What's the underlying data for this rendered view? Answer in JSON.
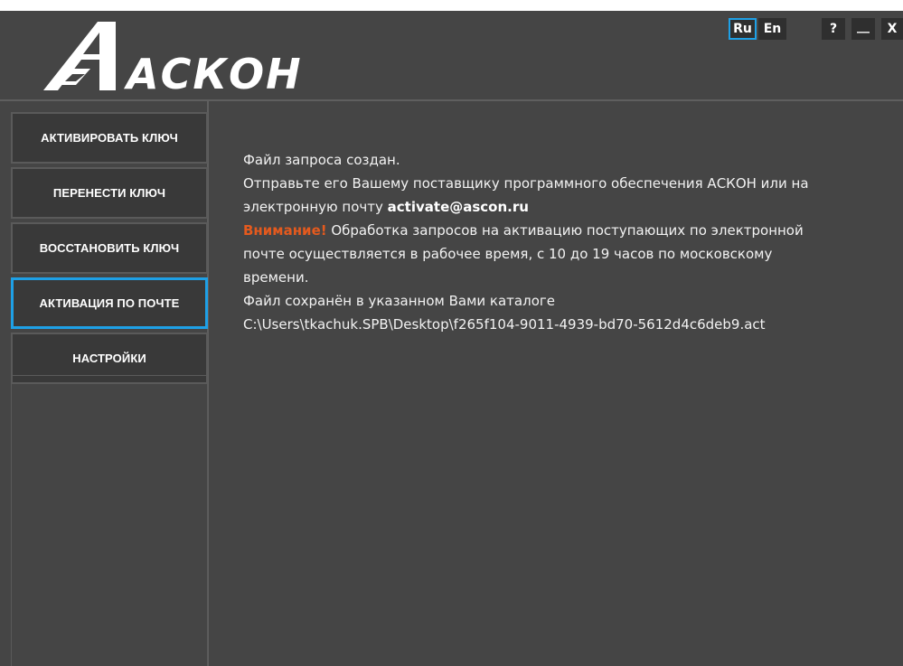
{
  "window": {
    "logo_text": "АСКОН",
    "languages": [
      {
        "label": "Ru",
        "active": true
      },
      {
        "label": "En",
        "active": false
      }
    ],
    "controls": {
      "help": "?",
      "minimize": "__",
      "close": "X"
    }
  },
  "sidebar": {
    "items": [
      {
        "label": "АКТИВИРОВАТЬ КЛЮЧ",
        "selected": false
      },
      {
        "label": "ПЕРЕНЕСТИ КЛЮЧ",
        "selected": false
      },
      {
        "label": "ВОССТАНОВИТЬ КЛЮЧ",
        "selected": false
      },
      {
        "label": "АКТИВАЦИЯ ПО ПОЧТЕ",
        "selected": true
      },
      {
        "label": "НАСТРОЙКИ",
        "selected": false
      }
    ]
  },
  "message": {
    "line1": "Файл запроса создан.",
    "line2": "Отправьте его Вашему поставщику программного обеспечения АСКОН или на",
    "line3_prefix": "электронную почту ",
    "email": "activate@ascon.ru",
    "warning_label": "Внимание!",
    "warning_line1": " Обработка запросов на активацию поступающих по электронной",
    "warning_line2": "почте осуществляется в рабочее время, с 10 до 19 часов по московскому",
    "warning_line3": "времени.",
    "saved_line": "Файл сохранён в указанном Вами каталоге",
    "path": "C:\\Users\\tkachuk.SPB\\Desktop\\f265f104-9011-4939-bd70-5612d4c6deb9.act"
  },
  "colors": {
    "background": "#454545",
    "accent": "#1ea0e6",
    "warning": "#e45a1e"
  }
}
